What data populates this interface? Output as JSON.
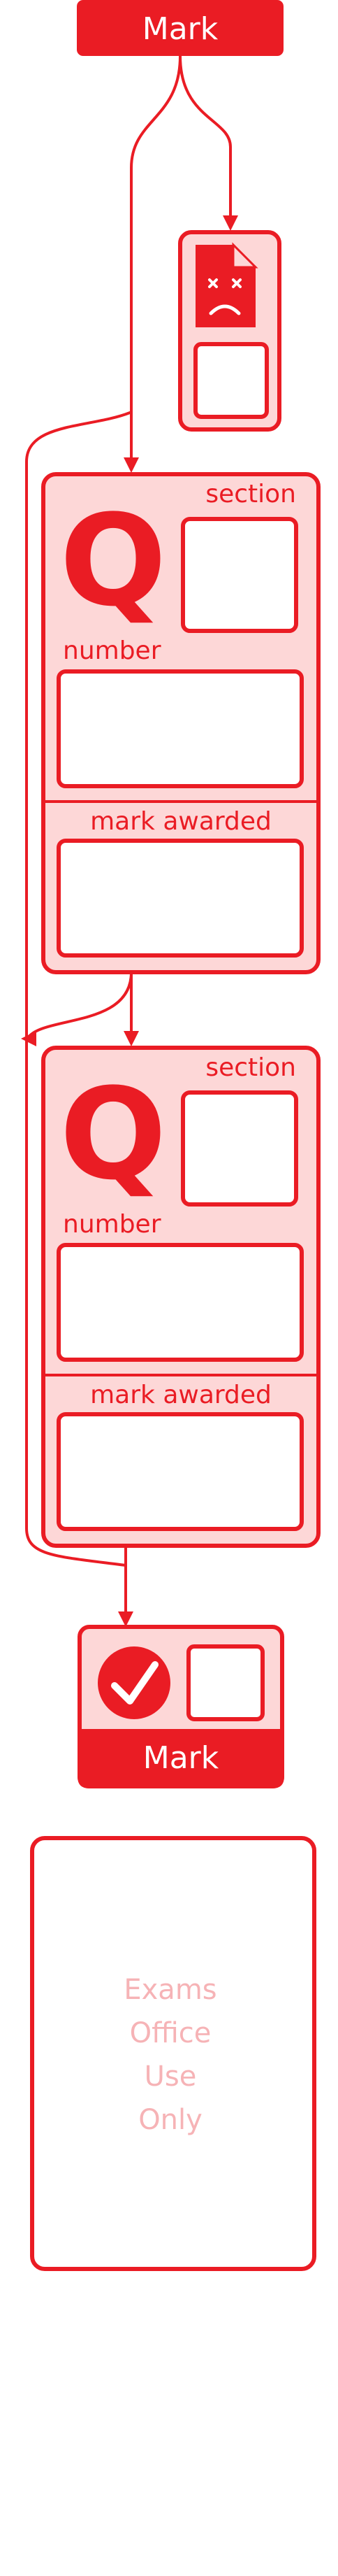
{
  "colors": {
    "primary": "#ea1c24",
    "tint": "#fdd7d7",
    "faint_text": "#f6b3b6",
    "white": "#ffffff"
  },
  "header": {
    "label": "Mark"
  },
  "error_card": {
    "icon": "sad-document-icon"
  },
  "question_cards": [
    {
      "q_glyph": "Q",
      "section_label": "section",
      "number_label": "number",
      "mark_awarded_label": "mark awarded"
    },
    {
      "q_glyph": "Q",
      "section_label": "section",
      "number_label": "number",
      "mark_awarded_label": "mark awarded"
    }
  ],
  "final_mark": {
    "label": "Mark",
    "icon": "checkmark-circle-icon"
  },
  "exams_office": {
    "lines": [
      "Exams",
      "Office",
      "Use",
      "Only"
    ]
  }
}
